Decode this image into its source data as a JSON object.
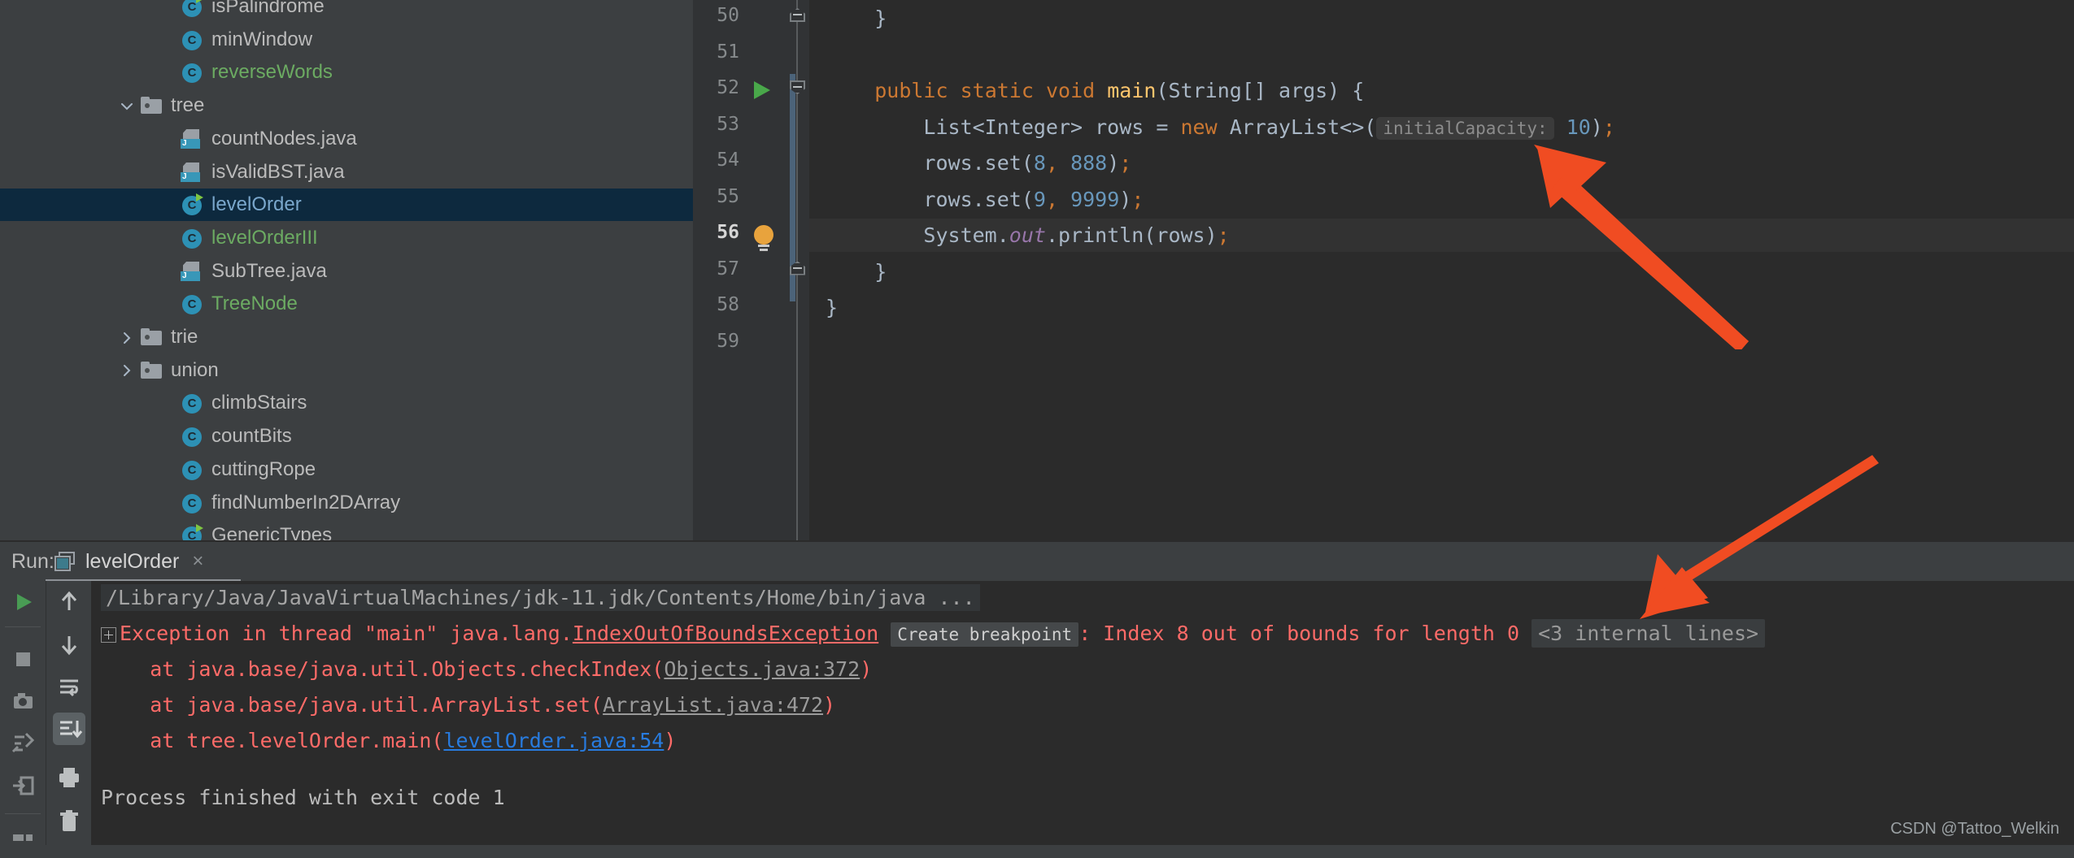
{
  "project_tree": {
    "items": [
      {
        "label": "isPalindrome",
        "icon": "class-runnable-icon",
        "kind": "class",
        "color": "plain",
        "indent": 220,
        "arrow": ""
      },
      {
        "label": "minWindow",
        "icon": "class-icon",
        "kind": "class",
        "color": "plain",
        "indent": 220,
        "arrow": ""
      },
      {
        "label": "reverseWords",
        "icon": "class-icon",
        "kind": "class",
        "color": "green",
        "indent": 220,
        "arrow": ""
      },
      {
        "label": "tree",
        "icon": "folder-icon",
        "kind": "folder",
        "color": "plain",
        "indent": 170,
        "arrow": "down"
      },
      {
        "label": "countNodes.java",
        "icon": "java-file-icon",
        "kind": "java",
        "color": "plain",
        "indent": 220,
        "arrow": ""
      },
      {
        "label": "isValidBST.java",
        "icon": "java-file-icon",
        "kind": "java",
        "color": "plain",
        "indent": 220,
        "arrow": ""
      },
      {
        "label": "levelOrder",
        "icon": "class-runnable-icon",
        "kind": "class",
        "color": "plain",
        "indent": 220,
        "arrow": "",
        "selected": true
      },
      {
        "label": "levelOrderIII",
        "icon": "class-icon",
        "kind": "class",
        "color": "green",
        "indent": 220,
        "arrow": ""
      },
      {
        "label": "SubTree.java",
        "icon": "java-file-icon",
        "kind": "java",
        "color": "plain",
        "indent": 220,
        "arrow": ""
      },
      {
        "label": "TreeNode",
        "icon": "class-icon",
        "kind": "class",
        "color": "green",
        "indent": 220,
        "arrow": ""
      },
      {
        "label": "trie",
        "icon": "folder-icon",
        "kind": "folder",
        "color": "plain",
        "indent": 170,
        "arrow": "right"
      },
      {
        "label": "union",
        "icon": "folder-icon",
        "kind": "folder",
        "color": "plain",
        "indent": 170,
        "arrow": "right"
      },
      {
        "label": "climbStairs",
        "icon": "class-icon",
        "kind": "class",
        "color": "plain",
        "indent": 220,
        "arrow": ""
      },
      {
        "label": "countBits",
        "icon": "class-icon",
        "kind": "class",
        "color": "plain",
        "indent": 220,
        "arrow": ""
      },
      {
        "label": "cuttingRope",
        "icon": "class-icon",
        "kind": "class",
        "color": "plain",
        "indent": 220,
        "arrow": ""
      },
      {
        "label": "findNumberIn2DArray",
        "icon": "class-icon",
        "kind": "class",
        "color": "plain",
        "indent": 220,
        "arrow": ""
      },
      {
        "label": "GenericTypes",
        "icon": "class-runnable-icon",
        "kind": "class",
        "color": "plain",
        "indent": 220,
        "arrow": ""
      }
    ]
  },
  "editor": {
    "line_numbers": [
      "50",
      "51",
      "52",
      "53",
      "54",
      "55",
      "56",
      "57",
      "58",
      "59"
    ],
    "current_line": "56",
    "gutter_run_marker_line": "52",
    "gutter_bulb_line": "56",
    "code_lines": [
      {
        "n": "50",
        "text": "    }"
      },
      {
        "n": "51",
        "text": ""
      },
      {
        "n": "52",
        "text": "    public static void main(String[] args) {"
      },
      {
        "n": "53",
        "text": "        List<Integer> rows = new ArrayList<>( initialCapacity: 10);"
      },
      {
        "n": "54",
        "text": "        rows.set(8, 888);"
      },
      {
        "n": "55",
        "text": "        rows.set(9, 9999);"
      },
      {
        "n": "56",
        "text": "        System.out.println(rows);"
      },
      {
        "n": "57",
        "text": "    }"
      },
      {
        "n": "58",
        "text": "}"
      },
      {
        "n": "59",
        "text": ""
      }
    ],
    "parameter_hint": "initialCapacity:"
  },
  "run_panel": {
    "label": "Run:",
    "tab_name": "levelOrder",
    "close_label": "×",
    "toolbar_left": [
      {
        "name": "rerun-button",
        "glyph": "play"
      },
      {
        "name": "stop-button",
        "glyph": "stop"
      },
      {
        "name": "screenshot-button",
        "glyph": "camera"
      },
      {
        "name": "thread-dump-button",
        "glyph": "threads"
      },
      {
        "name": "export-button",
        "glyph": "export"
      },
      {
        "name": "layout-button",
        "glyph": "layout"
      }
    ],
    "toolbar_right": [
      {
        "name": "up-the-stack-trace-button",
        "glyph": "arrow-up"
      },
      {
        "name": "down-the-stack-trace-button",
        "glyph": "arrow-down"
      },
      {
        "name": "soft-wrap-button",
        "glyph": "wrap"
      },
      {
        "name": "scroll-to-end-button",
        "glyph": "scroll-end",
        "selected": true
      },
      {
        "name": "print-button",
        "glyph": "printer"
      },
      {
        "name": "clear-all-button",
        "glyph": "trash"
      }
    ],
    "console": {
      "command_line": "/Library/Java/JavaVirtualMachines/jdk-11.jdk/Contents/Home/bin/java ...",
      "exception_prefix": "Exception in thread \"main\" java.lang.",
      "exception_type": "IndexOutOfBoundsException",
      "create_breakpoint_label": "Create breakpoint",
      "exception_message": ": Index 8 out of bounds for length 0",
      "internal_lines_label": "<3 internal lines>",
      "stack_frames": [
        {
          "prefix": "    at java.base/java.util.Objects.checkIndex(",
          "link": "Objects.java:372",
          "suffix": ")",
          "link_style": "gray"
        },
        {
          "prefix": "    at java.base/java.util.ArrayList.set(",
          "link": "ArrayList.java:472",
          "suffix": ")",
          "link_style": "gray"
        },
        {
          "prefix": "    at tree.levelOrder.main(",
          "link": "levelOrder.java:54",
          "suffix": ")",
          "link_style": "blue"
        }
      ],
      "exit_line": "Process finished with exit code 1"
    }
  },
  "annotations": {
    "arrow_color": "#f04c22",
    "arrow_count": 2
  },
  "watermark": "CSDN @Tattoo_Welkin",
  "colors": {
    "tree_bg": "#3c3f41",
    "editor_bg": "#2b2b2b",
    "gutter_bg": "#313335",
    "selection_bg": "#0d293e",
    "keyword": "#cc7832",
    "number": "#6897bb",
    "method": "#ffc66d",
    "error": "#ff6b68",
    "link_blue": "#287bde",
    "green_class": "#6cab62"
  }
}
